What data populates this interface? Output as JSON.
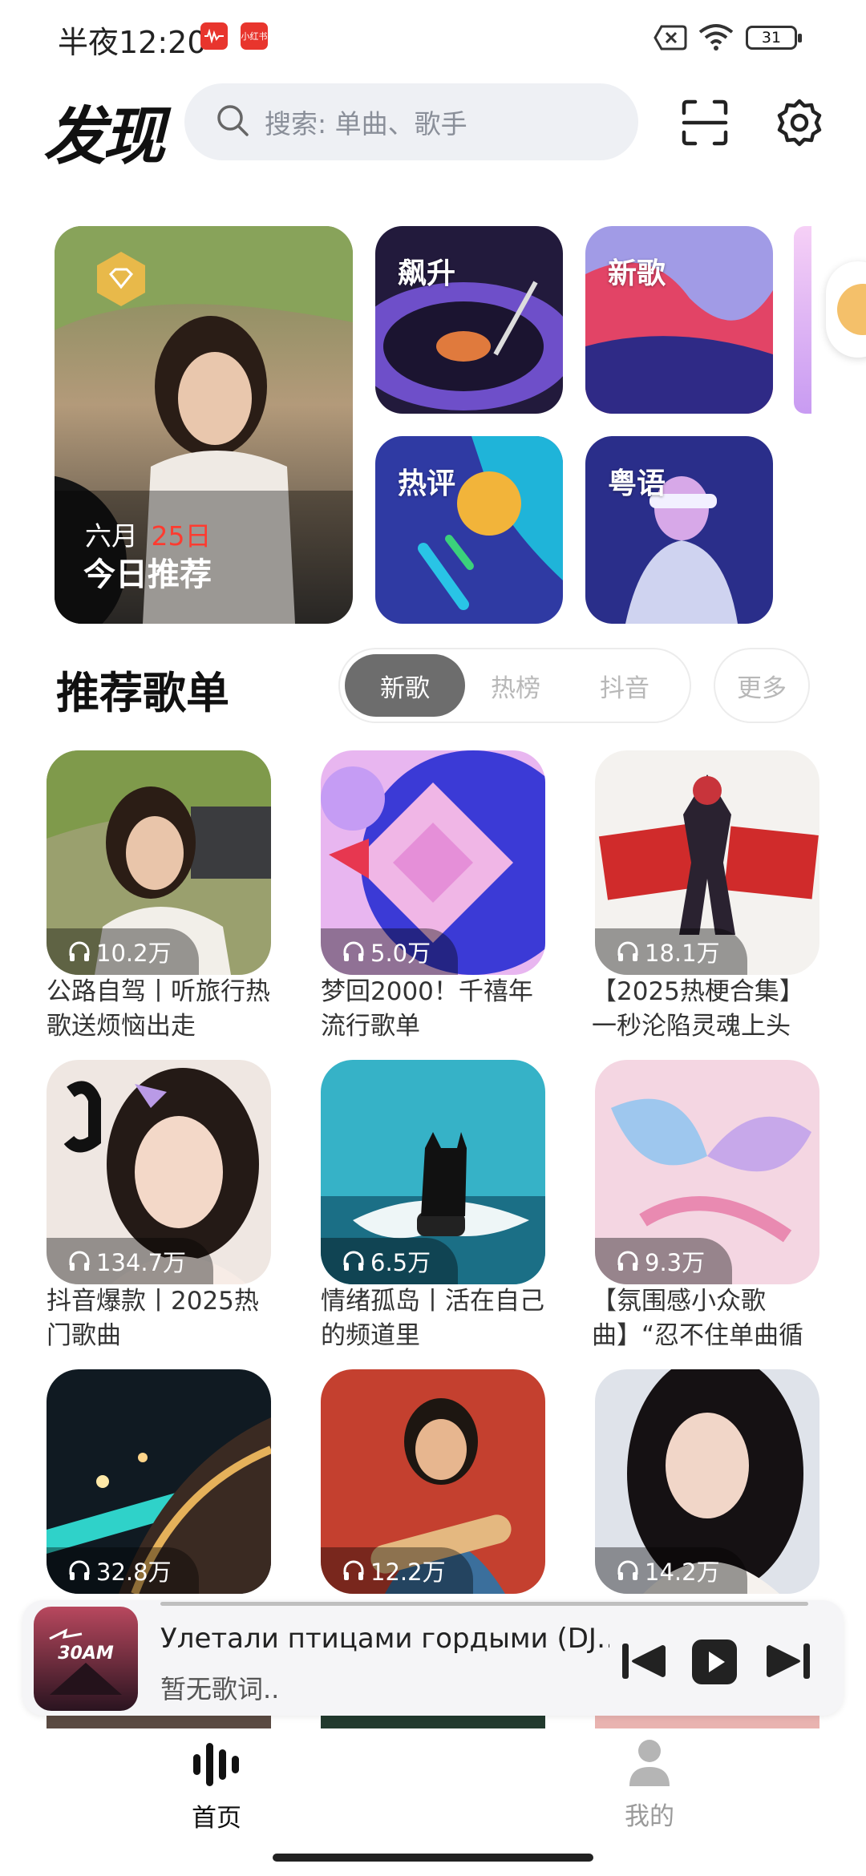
{
  "status_bar": {
    "time": "半夜12:20",
    "battery": "31",
    "app_badges": [
      "music-app-icon",
      "xiaohongshu-icon"
    ],
    "xiaohongshu_text": "小红书"
  },
  "header": {
    "title": "发现",
    "search_placeholder": "搜索: 单曲、歌手"
  },
  "hero": {
    "daily": {
      "month": "六月",
      "day": "25日",
      "title": "今日推荐"
    },
    "tiles": [
      "飙升",
      "新歌",
      "热评",
      "粤语"
    ]
  },
  "section": {
    "title": "推荐歌单",
    "tabs": [
      "新歌",
      "热榜",
      "抖音"
    ],
    "active_tab": "新歌",
    "more": "更多"
  },
  "playlists": [
    {
      "count": "10.2万",
      "title": "公路自驾丨听旅行热歌送烦恼出走"
    },
    {
      "count": "5.0万",
      "title": "梦回2000！千禧年流行歌单"
    },
    {
      "count": "18.1万",
      "title": "【2025热梗合集】一秒沦陷灵魂上头"
    },
    {
      "count": "134.7万",
      "title": "抖音爆款丨2025热门歌曲"
    },
    {
      "count": "6.5万",
      "title": "情绪孤岛丨活在自己的频道里"
    },
    {
      "count": "9.3万",
      "title": "【氛围感小众歌曲】“忍不住单曲循"
    },
    {
      "count": "32.8万",
      "title": ""
    },
    {
      "count": "12.2万",
      "title": ""
    },
    {
      "count": "14.2万",
      "title": ""
    }
  ],
  "player": {
    "title": "Улетали птицами гордыми (DJ…",
    "subtitle": "暂无歌词..",
    "cover_art_text": "30AM"
  },
  "bottom_nav": [
    {
      "label": "首页",
      "active": true
    },
    {
      "label": "我的",
      "active": false
    }
  ],
  "colors": {
    "accent_red": "#e8352d",
    "nav_active": "#111111",
    "nav_inactive": "#9a9a9a"
  }
}
